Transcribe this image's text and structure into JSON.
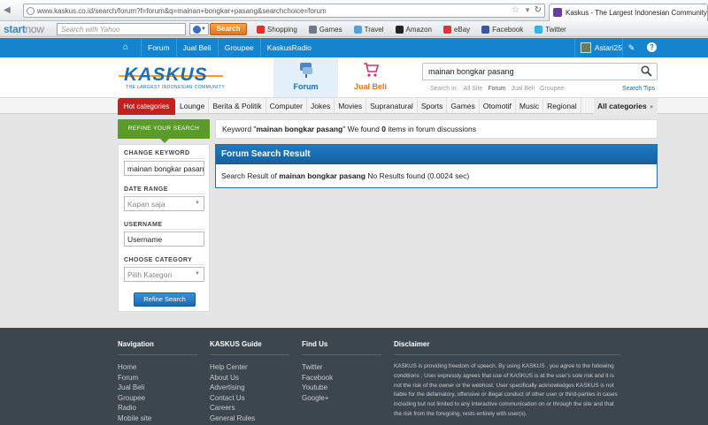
{
  "browser": {
    "url": "www.kaskus.co.id/search/forum?f=forum&q=mainan+bongkar+pasang&searchchoice=forum",
    "tab_title": "Kaskus - The Largest Indonesian Community"
  },
  "toolbar": {
    "logo_start": "start",
    "logo_now": "now",
    "search_placeholder": "Search with Yahoo",
    "search_button": "Search",
    "links": [
      "Shopping",
      "Games",
      "Travel",
      "Amazon",
      "eBay",
      "Facebook",
      "Twitter"
    ],
    "link_colors": [
      "#d9332b",
      "#6b7b8c",
      "#5aa0d8",
      "#222222",
      "#e53238",
      "#3b5998",
      "#33b4e8"
    ]
  },
  "topnav": {
    "links": [
      "Forum",
      "Jual Beli",
      "Groupee",
      "KaskusRadio"
    ],
    "username": "Astari25"
  },
  "header": {
    "logo_text": "KASKUS",
    "logo_sub": "THE LARGEST INDONESIAN COMMUNITY",
    "tab_forum": "Forum",
    "tab_jualbeli": "Jual Beli",
    "search_value": "mainan bongkar pasang",
    "scope_label": "Search in:",
    "scope_options": [
      "All Site",
      "Forum",
      "Jual Beli",
      "Groupee"
    ],
    "search_tips": "Search Tips"
  },
  "categories": {
    "hot": "Hot categories",
    "items": [
      "Lounge",
      "Berita & Politik",
      "Computer",
      "Jokes",
      "Movies",
      "Supranatural",
      "Sports",
      "Games",
      "Otomotif",
      "Music",
      "Regional"
    ],
    "all": "All categories"
  },
  "refine": {
    "header": "REFINE YOUR SEARCH",
    "keyword_label": "CHANGE KEYWORD",
    "keyword_value": "mainan bongkar pasang",
    "date_label": "DATE RANGE",
    "date_value": "Kapan saja",
    "username_label": "USERNAME",
    "username_value": "Username",
    "category_label": "CHOOSE CATEGORY",
    "category_value": "Pilih Kategori",
    "button": "Refine Search"
  },
  "keyword_bar": {
    "prefix": "Keyword \"",
    "keyword": "mainan bongkar pasang",
    "middle": "\" We found ",
    "count": "0",
    "suffix": " items in forum discussions"
  },
  "result": {
    "title": "Forum Search Result",
    "prefix": "Search Result of ",
    "keyword": "mainan bongkar pasang",
    "suffix": " No Results found (0.0024 sec)"
  },
  "footer": {
    "navigation": {
      "title": "Navigation",
      "links": [
        "Home",
        "Forum",
        "Jual Beli",
        "Groupee",
        "Radio",
        "Mobile site"
      ]
    },
    "guide": {
      "title": "KASKUS Guide",
      "links": [
        "Help Center",
        "About Us",
        "Advertising",
        "Contact Us",
        "Careers",
        "General Rules"
      ]
    },
    "findus": {
      "title": "Find Us",
      "links": [
        "Twitter",
        "Facebook",
        "Youtube",
        "Google+"
      ]
    },
    "disclaimer": {
      "title": "Disclaimer",
      "text": "KASKUS is providing freedom of speech. By using KASKUS , you agree to the following conditions ; User expressly agrees that use of KASKUS is at the user's sole risk and it is not the risk of the owner or the webhost. User specifically acknowledges KASKUS is not liable for the defamatory, offensive or illegal conduct of other user or third-parties in cases including but not limited to any interactive communication on or through the site and that the risk from the foregoing, rests entirely with user(s)."
    }
  }
}
